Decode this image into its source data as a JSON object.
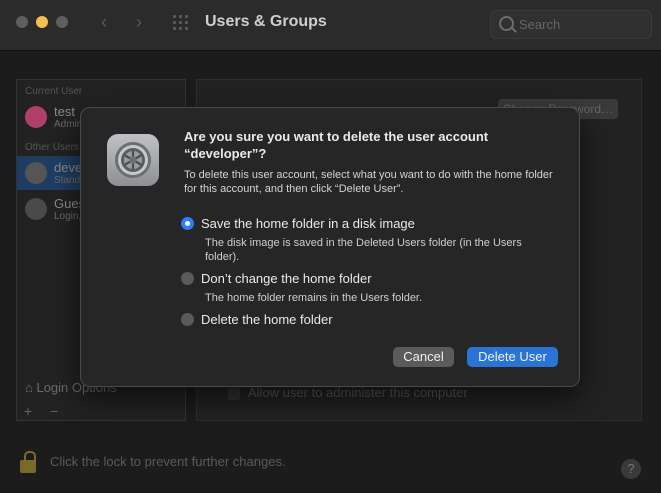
{
  "window": {
    "title": "Users & Groups",
    "search_placeholder": "Search"
  },
  "sidebar": {
    "current_user_header": "Current User",
    "other_users_header": "Other Users",
    "users": [
      {
        "name": "test",
        "role": "Admin"
      },
      {
        "name": "developer",
        "role": "Standard"
      },
      {
        "name": "Guest User",
        "role": "Login, Sharing"
      }
    ],
    "login_options_label": "Login Options",
    "add_label": "+",
    "remove_label": "−"
  },
  "main": {
    "change_password_label": "Change Password…",
    "admin_checkbox_label": "Allow user to administer this computer",
    "lock_text": "Click the lock to prevent further changes.",
    "help_label": "?"
  },
  "dialog": {
    "title": "Are you sure you want to delete the user account “developer”?",
    "message": "To delete this user account, select what you want to do with the home folder for this account, and then click “Delete User”.",
    "options": [
      {
        "label": "Save the home folder in a disk image",
        "description": "The disk image is saved in the Deleted Users folder (in the Users folder).",
        "selected": true
      },
      {
        "label": "Don’t change the home folder",
        "description": "The home folder remains in the Users folder.",
        "selected": false
      },
      {
        "label": "Delete the home folder",
        "description": "",
        "selected": false
      }
    ],
    "cancel_label": "Cancel",
    "confirm_label": "Delete User"
  },
  "colors": {
    "accent": "#2a74d8",
    "dialog_bg": "#262626",
    "minimize_light": "#f4bf4f"
  }
}
